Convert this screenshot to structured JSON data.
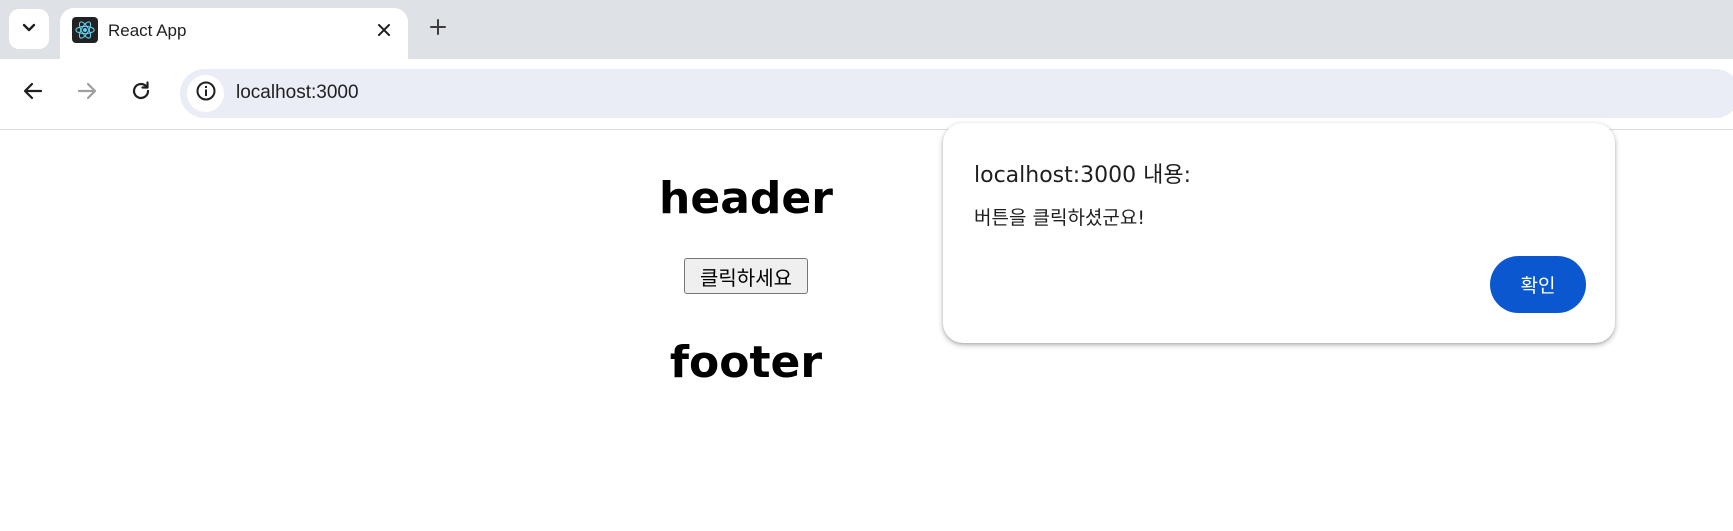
{
  "browser": {
    "tab": {
      "title": "React App",
      "favicon": "react-logo-icon"
    },
    "url": "localhost:3000",
    "icons": {
      "tab_search": "chevron-down-icon",
      "tab_close": "close-icon",
      "new_tab": "plus-icon",
      "back": "back-arrow-icon",
      "forward": "forward-arrow-icon",
      "reload": "reload-icon",
      "site_info": "info-icon"
    },
    "colors": {
      "tabstrip_bg": "#dee1e6",
      "omnibox_bg": "#eaedf5",
      "react_blue": "#61dafb"
    }
  },
  "app": {
    "header": "header",
    "button_label": "클릭하세요",
    "footer": "footer"
  },
  "alert": {
    "title": "localhost:3000 내용:",
    "message": "버튼을 클릭하셨군요!",
    "ok_label": "확인",
    "accent": "#0b57d0"
  }
}
